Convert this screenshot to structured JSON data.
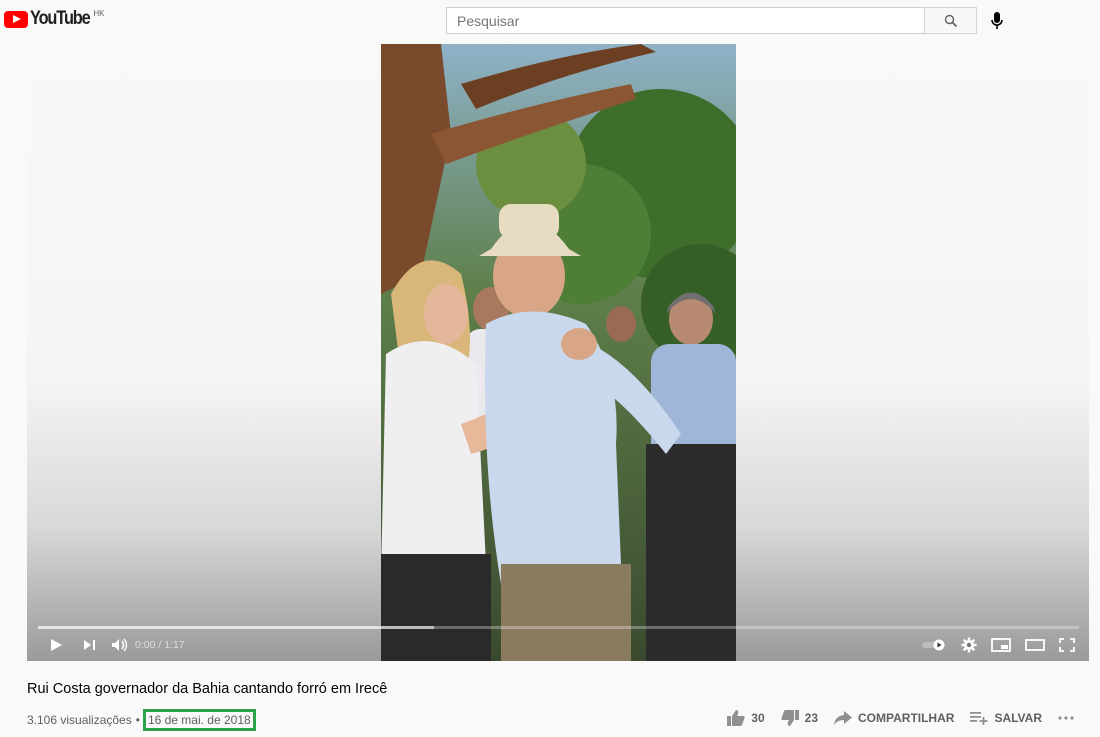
{
  "header": {
    "logo_text": "YouTube",
    "country_code": "HK",
    "search_placeholder": "Pesquisar",
    "search_icon": "search-icon",
    "mic_icon": "mic-icon"
  },
  "player": {
    "time_display": "0:00 / 1:17",
    "buffered_fraction": 0.38,
    "icons": [
      "play-icon",
      "next-icon",
      "volume-icon",
      "autoplay-toggle-icon",
      "settings-icon",
      "miniplayer-icon",
      "theater-icon",
      "fullscreen-icon"
    ]
  },
  "video": {
    "title": "Rui Costa governador da Bahia cantando forró em Irecê",
    "views": "3.106 visualizações",
    "separator": "•",
    "date": "16 de mai. de 2018",
    "likes": "30",
    "dislikes": "23",
    "share_label": "COMPARTILHAR",
    "save_label": "SALVAR"
  },
  "colors": {
    "brand_red": "#ff0000",
    "highlight_green": "#2da24c",
    "text_secondary": "#606060"
  }
}
